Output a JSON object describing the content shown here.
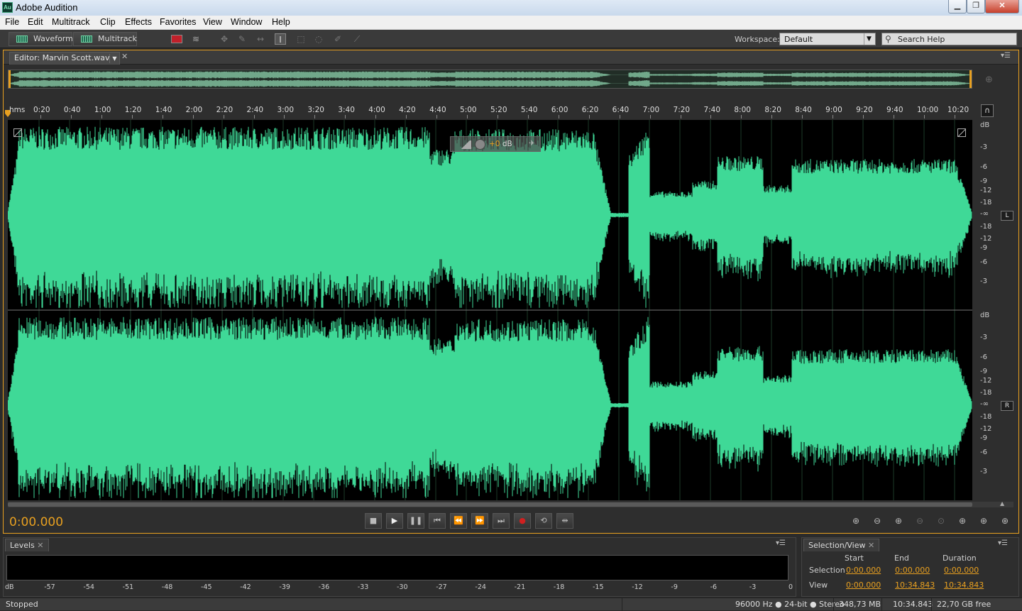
{
  "window": {
    "title": "Adobe Audition",
    "app_icon": "Au",
    "controls": [
      "minimize",
      "maximize",
      "close"
    ]
  },
  "menu": [
    "File",
    "Edit",
    "Multitrack",
    "Clip",
    "Effects",
    "Favorites",
    "View",
    "Window",
    "Help"
  ],
  "toolbar": {
    "waveform_label": "Waveform",
    "multitrack_label": "Multitrack",
    "workspace_label": "Workspace:",
    "workspace_value": "Default",
    "search_placeholder": "Search Help"
  },
  "editor": {
    "tab_label": "Editor: Marvin Scott.wav",
    "hud_value_prefix": "+0",
    "hud_value_unit": "dB",
    "ruler_unit": "hms",
    "ruler_ticks": [
      "0:20",
      "0:40",
      "1:00",
      "1:20",
      "1:40",
      "2:00",
      "2:20",
      "2:40",
      "3:00",
      "3:20",
      "3:40",
      "4:00",
      "4:20",
      "4:40",
      "5:00",
      "5:20",
      "5:40",
      "6:00",
      "6:20",
      "6:40",
      "7:00",
      "7:20",
      "7:40",
      "8:00",
      "8:20",
      "8:40",
      "9:00",
      "9:20",
      "9:40",
      "10:00",
      "10:20"
    ],
    "db_label": "dB",
    "db_scale_top": [
      "-3",
      "-6",
      "-9",
      "-12",
      "-18",
      "-∞",
      "-18",
      "-12",
      "-9",
      "-6",
      "-3"
    ],
    "db_scale_bottom": [
      "-3",
      "-6",
      "-9",
      "-12",
      "-18",
      "-∞",
      "-18",
      "-12",
      "-9",
      "-6",
      "-3"
    ],
    "channel_left": "L",
    "channel_right": "R",
    "current_time": "0:00.000",
    "waveform_color": "#3fd997",
    "accent_color": "#e8a020"
  },
  "levels": {
    "tab_label": "Levels",
    "scale": [
      "dB",
      "-57",
      "-54",
      "-51",
      "-48",
      "-45",
      "-42",
      "-39",
      "-36",
      "-33",
      "-30",
      "-27",
      "-24",
      "-21",
      "-18",
      "-15",
      "-12",
      "-9",
      "-6",
      "-3",
      "0"
    ]
  },
  "selection_view": {
    "tab_label": "Selection/View",
    "headers": [
      "Start",
      "End",
      "Duration"
    ],
    "rows": [
      {
        "label": "Selection",
        "start": "0:00.000",
        "end": "0:00.000",
        "duration": "0:00.000"
      },
      {
        "label": "View",
        "start": "0:00.000",
        "end": "10:34.843",
        "duration": "10:34.843"
      }
    ]
  },
  "status": {
    "state": "Stopped",
    "format": "96000 Hz ● 24-bit ● Stereo",
    "size": "348,73 MB",
    "duration": "10:34.843",
    "free": "22,70 GB free"
  }
}
